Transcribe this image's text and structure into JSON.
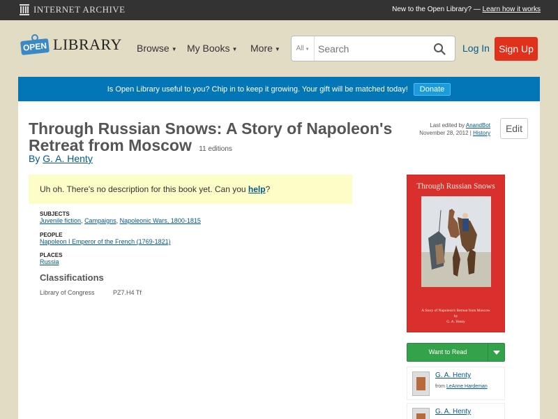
{
  "ia_bar": {
    "logo_text": "Internet Archive",
    "new_text": "New to the Open Library? —",
    "learn_link": "Learn how it works"
  },
  "header": {
    "logo_badge": "OPEN",
    "logo_word": "LIBRARY",
    "nav": [
      "Browse",
      "My Books",
      "More"
    ],
    "search_category": "All",
    "search_placeholder": "Search",
    "login": "Log In",
    "signup": "Sign Up"
  },
  "banner": {
    "text": "Is Open Library useful to you? Chip in to keep it growing. Your gift will be matched today!",
    "donate": "Donate"
  },
  "book": {
    "title": "Through Russian Snows: A Story of Napoleon's Retreat from Moscow",
    "editions": "11 editions",
    "by": "By",
    "author": "G. A. Henty",
    "last_edited_prefix": "Last edited by",
    "last_edited_user": "AnandBot",
    "last_edited_date": "November 28, 2012 |",
    "history": "History",
    "edit": "Edit",
    "nodesc_text": "Uh oh. There's no description for this book yet. Can you",
    "nodesc_link": "help",
    "nodesc_end": "?",
    "subjects_head": "Subjects",
    "subjects": [
      "Juvenile fiction",
      "Campaigns",
      "Napoleonic Wars, 1800-1815"
    ],
    "people_head": "People",
    "people": [
      "Napoleon I Emperor of the French (1769-1821)"
    ],
    "places_head": "Places",
    "places": [
      "Russia"
    ],
    "classifications_head": "Classifications",
    "loc_label": "Library of Congress",
    "loc_value": "PZ7.H4 Tf"
  },
  "cover": {
    "title": "Through Russian Snows",
    "subtitle": "A Story of Napoleon's Retreat from Moscow",
    "by": "by",
    "author": "G. A. Henty"
  },
  "want_to_read": "Want to Read",
  "lists": [
    {
      "name": "G. A. Henty",
      "from_prefix": "from",
      "from_user": "LeAnne Hardeman"
    },
    {
      "name": "G. A. Henty",
      "from_prefix": "",
      "from_user": ""
    }
  ],
  "colors": {
    "signup": "#e1301c",
    "banner": "#0376b8",
    "want_to_read": "#33a24a",
    "cover": "#d9302d",
    "link": "#02598b"
  }
}
